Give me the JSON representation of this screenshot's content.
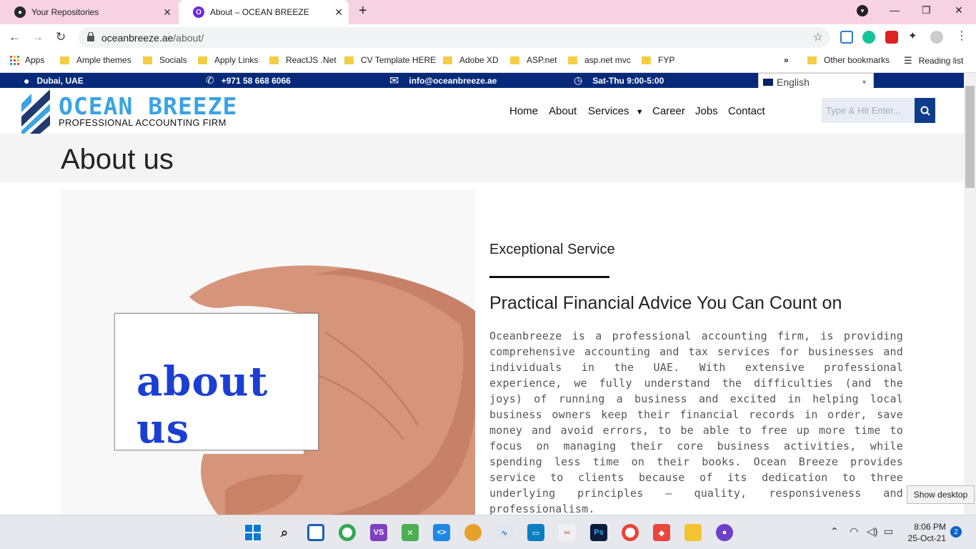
{
  "browser": {
    "tabs": [
      {
        "title": "Your Repositories",
        "active": false
      },
      {
        "title": "About – OCEAN BREEZE",
        "active": true
      }
    ],
    "url_host": "oceanbreeze.ae",
    "url_path": "/about/",
    "bookmarks": [
      {
        "label": "Apps",
        "icon": "apps-grid-icon"
      },
      {
        "label": "Ample themes",
        "icon": "folder-icon"
      },
      {
        "label": "Socials",
        "icon": "folder-icon"
      },
      {
        "label": "Apply Links",
        "icon": "folder-icon"
      },
      {
        "label": "ReactJS .Net",
        "icon": "folder-icon"
      },
      {
        "label": "CV Template HERE",
        "icon": "folder-icon"
      },
      {
        "label": "Adobe XD",
        "icon": "folder-icon"
      },
      {
        "label": "ASP.net",
        "icon": "folder-icon"
      },
      {
        "label": "asp.net mvc",
        "icon": "folder-icon"
      },
      {
        "label": "FYP",
        "icon": "folder-icon"
      }
    ],
    "overflow_label": "»",
    "other_bookmarks": "Other bookmarks",
    "reading_list": "Reading list"
  },
  "site": {
    "topbar": {
      "location": "Dubai, UAE",
      "phone": "+971 58 668 6066",
      "email": "info@oceanbreeze.ae",
      "hours": "Sat-Thu 9:00-5:00"
    },
    "language": "English",
    "logo_title": "OCEAN BREEZE",
    "logo_subtitle": "PROFESSIONAL ACCOUNTING FIRM",
    "nav": [
      "Home",
      "About",
      "Services",
      "Career",
      "Jobs",
      "Contact"
    ],
    "search_placeholder": "Type & Hit Enter...",
    "page_title": "About us",
    "hero_card_text": "about us",
    "section_kicker": "Exceptional Service",
    "section_heading": "Practical Financial Advice You Can Count on",
    "section_body": "Oceanbreeze is a professional accounting firm, is providing comprehensive accounting and tax services for businesses and individuals in the UAE. With extensive professional experience, we fully understand the difficulties (and the joys) of running a business and excited in helping local business owners keep their financial records in order, save money and avoid errors, to be able to free up more time to focus on managing their core business activities, while spending less time on their books. Ocean Breeze provides service to clients because of its dedication to three underlying principles – quality, responsiveness and professionalism.",
    "colors": {
      "topbar": "#062a79",
      "logo_blue": "#3aa3e3",
      "button_blue": "#0d3d8a"
    }
  },
  "tooltip": "Show desktop",
  "taskbar": {
    "time": "8:06 PM",
    "date": "25-Oct-21",
    "notification_count": "2"
  }
}
